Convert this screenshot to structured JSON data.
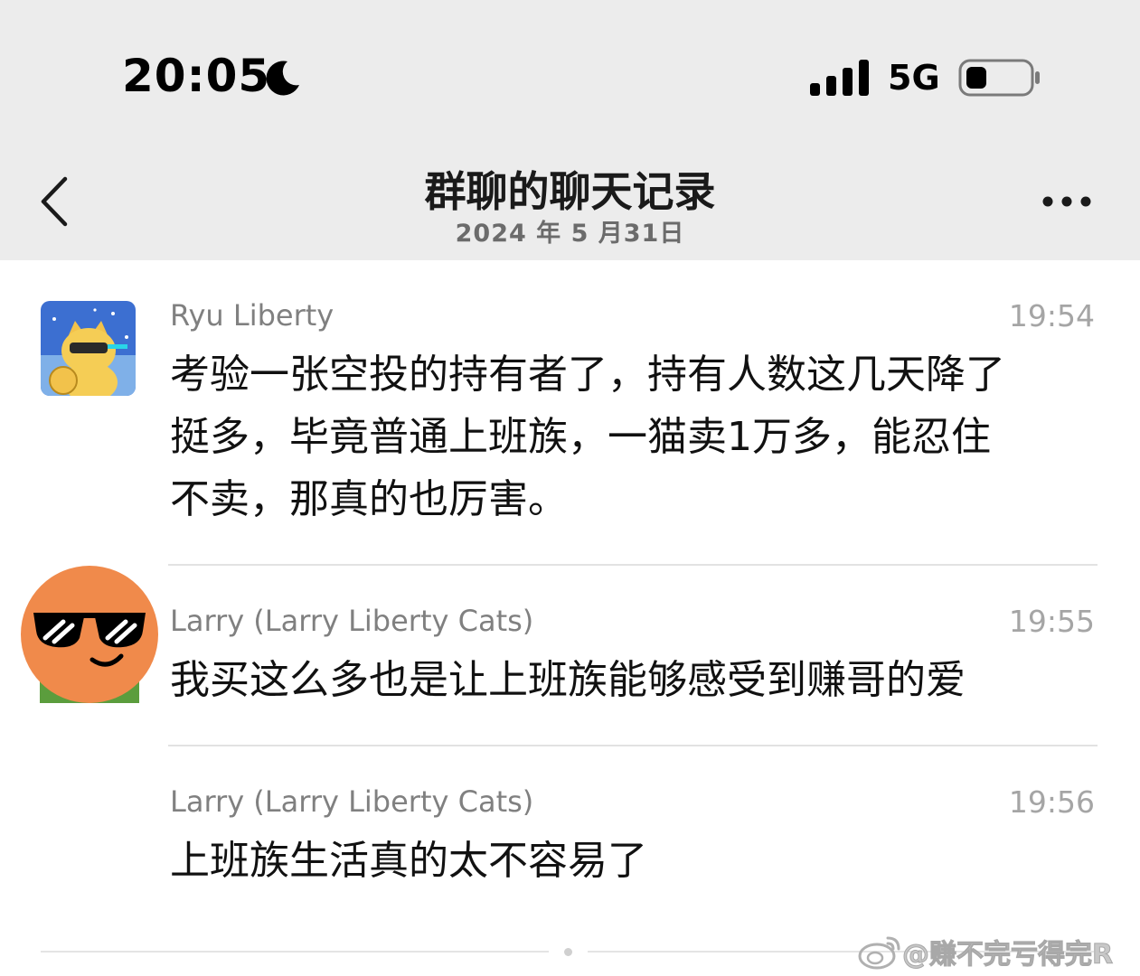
{
  "status_bar": {
    "time": "20:05",
    "network": "5G",
    "moon_icon": "moon-icon",
    "signal_icon": "signal-icon",
    "battery_icon": "battery-icon"
  },
  "nav": {
    "title": "群聊的聊天记录",
    "subtitle": "2024 年 5 月31日",
    "back_icon": "chevron-left-icon",
    "more_icon": "more-dots-icon"
  },
  "messages": [
    {
      "sender": "Ryu Liberty",
      "time": "19:54",
      "lines": [
        "考验一张空投的持有者了，持有人数这几天降了",
        "挺多，毕竟普通上班族，一猫卖1万多，能忍住",
        "不卖，那真的也厉害。"
      ]
    },
    {
      "sender": "Larry (Larry Liberty Cats)",
      "time": "19:55",
      "lines": [
        "我买这么多也是让上班族能够感受到赚哥的爱"
      ]
    },
    {
      "sender": "Larry (Larry Liberty Cats)",
      "time": "19:56",
      "lines": [
        "上班族生活真的太不容易了"
      ]
    }
  ],
  "watermark": "@赚不完亏得完R",
  "colors": {
    "header_bg": "#ececec",
    "sender_gray": "#808080",
    "time_gray": "#a5a5a5",
    "divider": "#e2e2e2"
  }
}
